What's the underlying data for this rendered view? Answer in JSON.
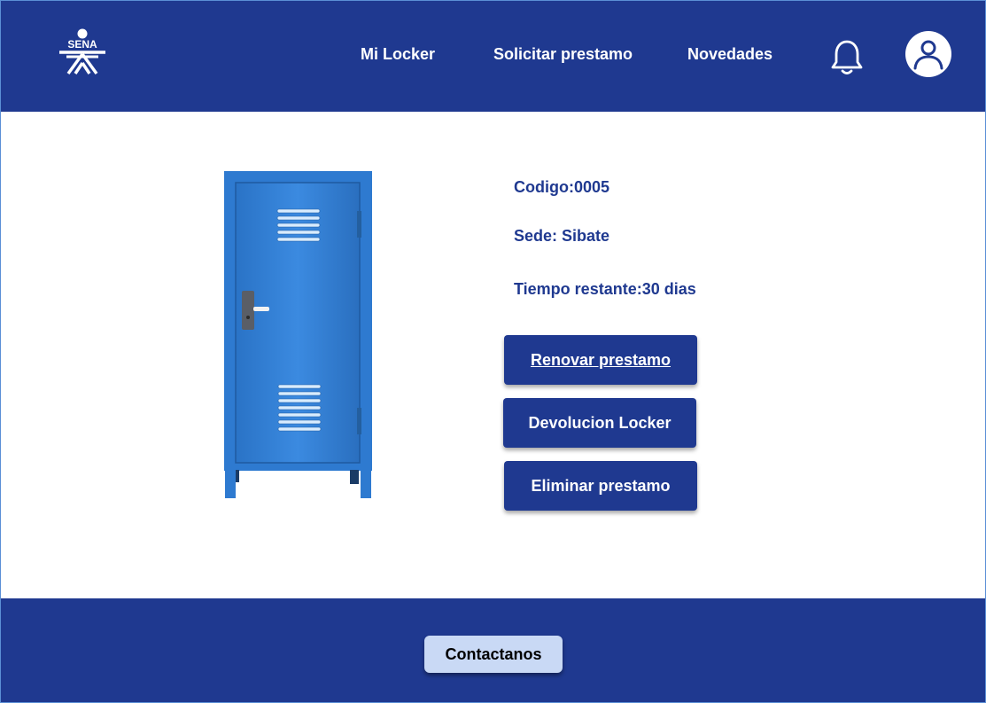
{
  "header": {
    "logo_text": "SENA",
    "nav": {
      "mi_locker": "Mi Locker",
      "solicitar_prestamo": "Solicitar prestamo",
      "novedades": "Novedades"
    },
    "icons": [
      "bell-icon",
      "user-avatar-icon"
    ]
  },
  "locker": {
    "codigo": "Codigo:0005",
    "sede": "Sede: Sibate",
    "tiempo_restante": "Tiempo restante:30 dias"
  },
  "actions": {
    "renovar": "Renovar prestamo",
    "devolucion": "Devolucion Locker",
    "eliminar": "Eliminar prestamo"
  },
  "footer": {
    "contact_label": "Contactanos"
  },
  "colors": {
    "primary": "#1f3990",
    "locker_blue": "#2f7ed4",
    "contact_button": "#c9d9f5",
    "background": "#ffffff"
  }
}
